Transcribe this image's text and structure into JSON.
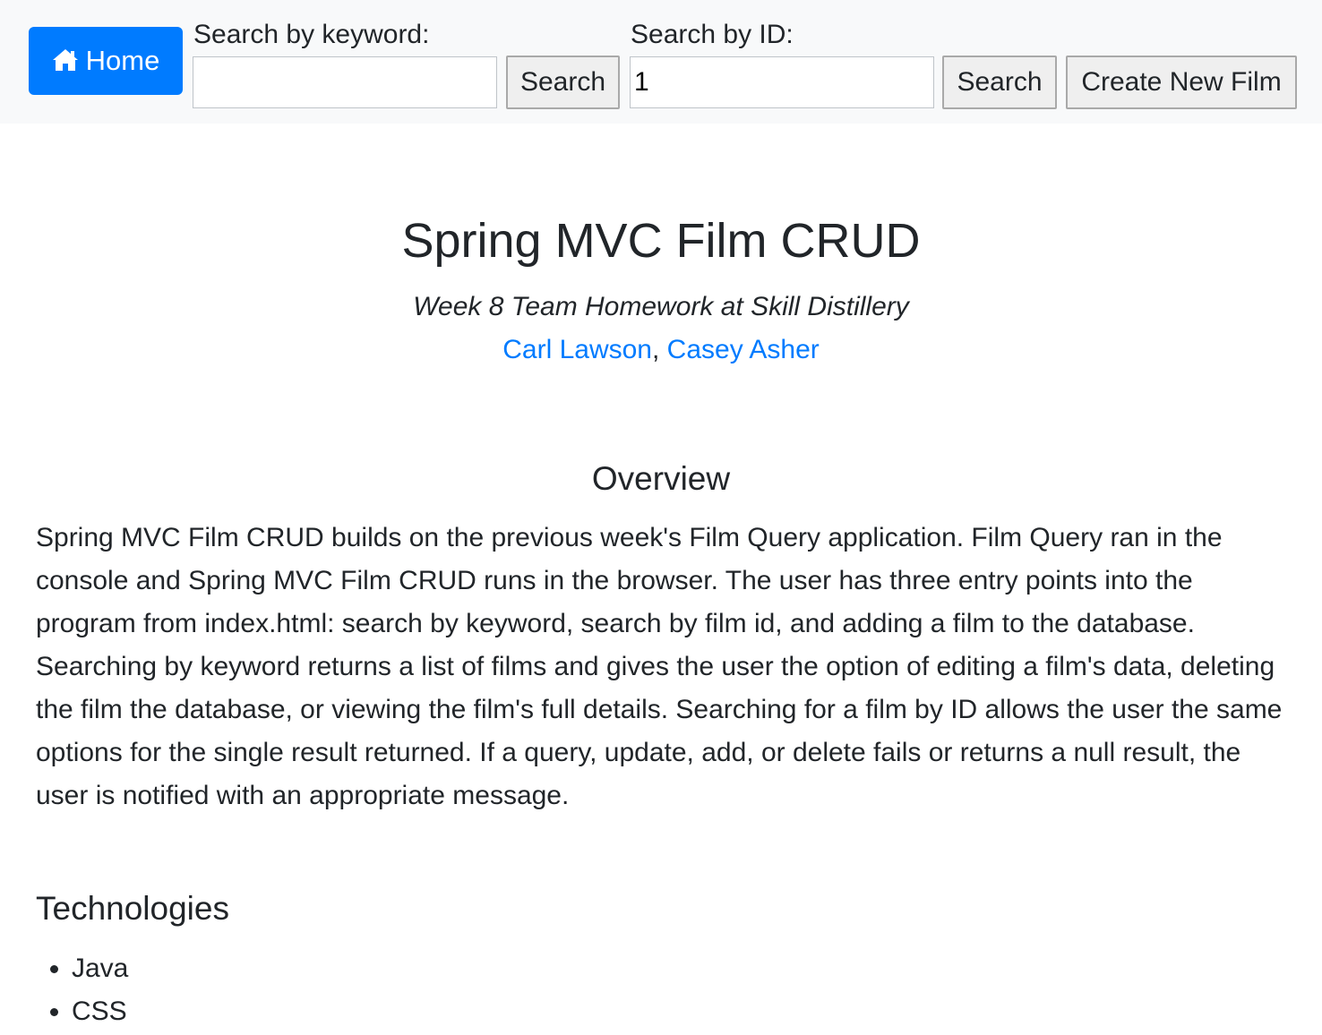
{
  "navbar": {
    "home_label": "Home",
    "keyword": {
      "label": "Search by keyword:",
      "value": "",
      "button": "Search"
    },
    "id_search": {
      "label": "Search by ID:",
      "value": "1",
      "button": "Search"
    },
    "create_button": "Create New Film"
  },
  "header": {
    "title": "Spring MVC Film CRUD",
    "subtitle": "Week 8 Team Homework at Skill Distillery",
    "authors": [
      {
        "name": "Carl Lawson"
      },
      {
        "name": "Casey Asher"
      }
    ],
    "author_separator": ", "
  },
  "overview": {
    "heading": "Overview",
    "text": "Spring MVC Film CRUD builds on the previous week's Film Query application. Film Query ran in the console and Spring MVC Film CRUD runs in the browser. The user has three entry points into the program from index.html: search by keyword, search by film id, and adding a film to the database. Searching by keyword returns a list of films and gives the user the option of editing a film's data, deleting the film the database, or viewing the film's full details. Searching for a film by ID allows the user the same options for the single result returned. If a query, update, add, or delete fails or returns a null result, the user is notified with an appropriate message."
  },
  "technologies": {
    "heading": "Technologies",
    "items": [
      "Java",
      "CSS"
    ]
  },
  "colors": {
    "primary": "#007bff",
    "navbar_bg": "#f8f9fa",
    "text": "#212529"
  }
}
